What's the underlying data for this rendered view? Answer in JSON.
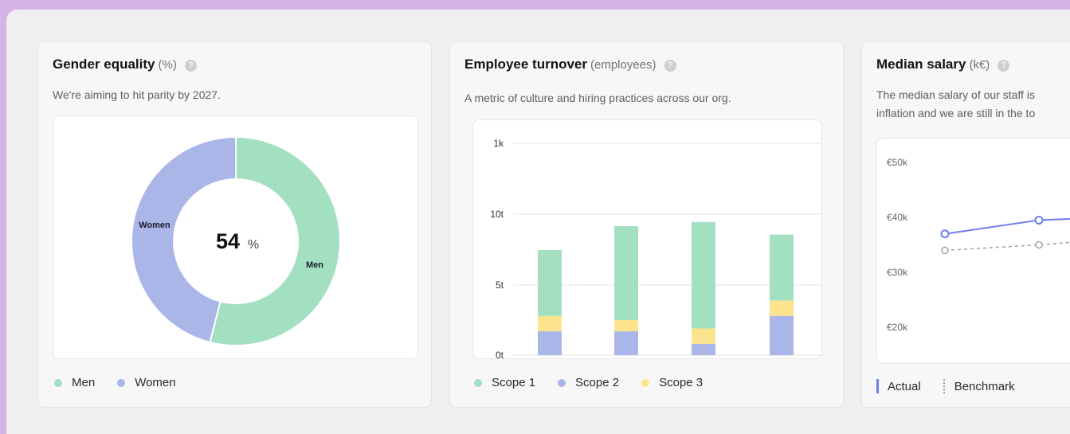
{
  "colors": {
    "men": "#a3e0c2",
    "women": "#aab5e8",
    "scope1": "#a3e0c2",
    "scope2": "#aab5e8",
    "scope3": "#fce48f",
    "actual": "#6f7ff0",
    "benchmark": "#a0a0a8"
  },
  "gender": {
    "title": "Gender equality",
    "unit": "(%)",
    "help": "?",
    "description": "We're aiming to hit parity by 2027.",
    "center_value": "54",
    "center_suffix": "%",
    "label_women": "Women",
    "label_men": "Men",
    "legend": [
      "Men",
      "Women"
    ]
  },
  "turnover": {
    "title": "Employee turnover",
    "unit": "(employees)",
    "help": "?",
    "description": "A metric of culture and hiring practices across our org.",
    "y_ticks": [
      "1k",
      "10t",
      "5t",
      "0t"
    ],
    "legend": [
      "Scope 1",
      "Scope 2",
      "Scope 3"
    ]
  },
  "salary": {
    "title": "Median salary",
    "unit": "(k€)",
    "help": "?",
    "description_line1": "The median salary of our staff is",
    "description_line2": "inflation and we are still in the to",
    "y_ticks": [
      "€50k",
      "€40k",
      "€30k",
      "€20k"
    ],
    "legend_actual": "Actual",
    "legend_benchmark": "Benchmark"
  },
  "chart_data": [
    {
      "type": "pie",
      "labels": [
        "Men",
        "Women"
      ],
      "values": [
        54,
        46
      ]
    },
    {
      "type": "bar",
      "stacked": true,
      "y_ticks": [
        "0t",
        "5t",
        "10t",
        "1k"
      ],
      "series": [
        {
          "name": "Scope 2",
          "values": [
            1.7,
            1.7,
            0.8,
            2.8
          ]
        },
        {
          "name": "Scope 3",
          "values": [
            1.1,
            0.8,
            1.1,
            1.1
          ]
        },
        {
          "name": "Scope 1",
          "values": [
            4.7,
            6.7,
            7.6,
            4.7
          ]
        }
      ],
      "ylim": [
        0,
        15
      ]
    },
    {
      "type": "line",
      "series": [
        {
          "name": "Actual",
          "values": [
            37,
            39.5,
            40
          ]
        },
        {
          "name": "Benchmark",
          "values": [
            34,
            35,
            36
          ]
        }
      ],
      "ylim": [
        20,
        50
      ]
    }
  ]
}
